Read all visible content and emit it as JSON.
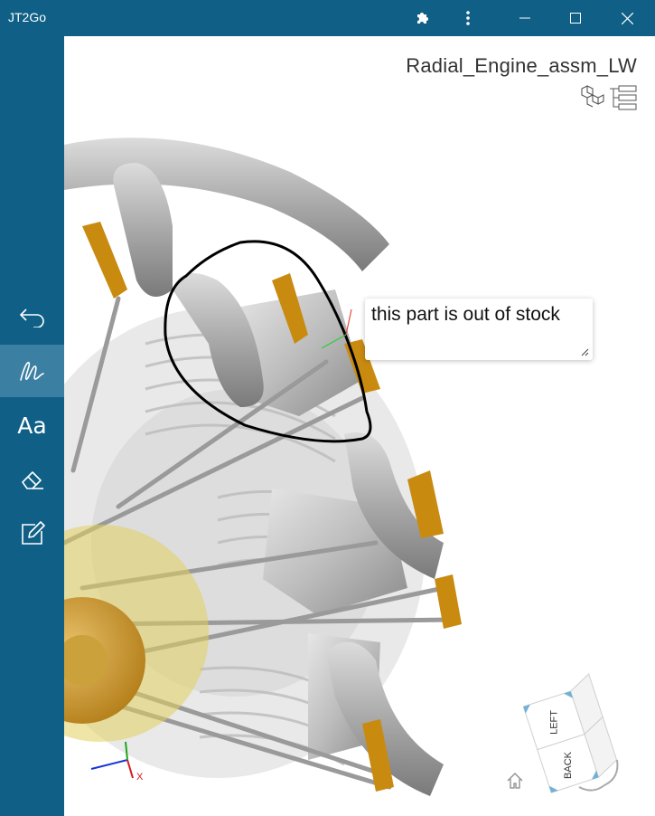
{
  "app": {
    "title": "JT2Go"
  },
  "titlebar": {
    "icons": [
      "puzzle-icon",
      "more-vertical-icon",
      "minimize-icon",
      "maximize-icon",
      "close-icon"
    ]
  },
  "sidebar": {
    "tools": [
      {
        "name": "undo",
        "icon": "undo-icon"
      },
      {
        "name": "freehand-markup",
        "icon": "pen-scribble-icon",
        "active": true
      },
      {
        "name": "text-markup",
        "icon": "text-icon",
        "label": "Aa"
      },
      {
        "name": "eraser",
        "icon": "eraser-icon"
      },
      {
        "name": "note",
        "icon": "edit-note-icon"
      }
    ]
  },
  "viewer": {
    "model_title": "Radial_Engine_assm_LW",
    "note_text": "this part is out of stock",
    "structure_icons": [
      "model-tree-cubes-icon",
      "structure-list-icon"
    ],
    "nav_cube_faces": [
      "LEFT",
      "BACK"
    ],
    "triad_label": "X",
    "colors": {
      "sidebar": "#0f5f86",
      "active_tool": "#3b7fa3",
      "markup_stroke": "#000000"
    }
  }
}
